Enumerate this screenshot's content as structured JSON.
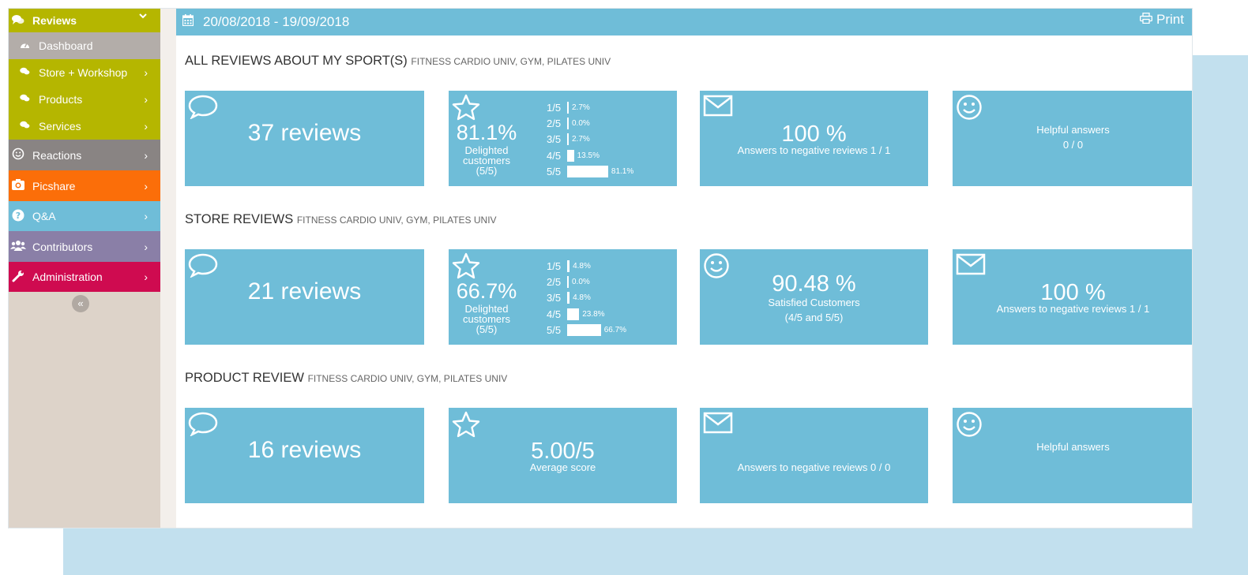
{
  "sidebar": {
    "items": [
      {
        "label": "Reviews",
        "icon": "comments-icon",
        "color": "#b5b600",
        "chevron": "⌄"
      },
      {
        "label": "Dashboard",
        "icon": "dashboard-icon",
        "color": "#b3ada9"
      },
      {
        "label": "Store + Workshop",
        "icon": "comments-icon",
        "color": "#b5b600",
        "chevron": "›"
      },
      {
        "label": "Products",
        "icon": "comments-icon",
        "color": "#b5b600",
        "chevron": "›"
      },
      {
        "label": "Services",
        "icon": "comments-icon",
        "color": "#b5b600",
        "chevron": "›"
      },
      {
        "label": "Reactions",
        "icon": "smile-icon",
        "color": "#898483",
        "chevron": "›"
      },
      {
        "label": "Picshare",
        "icon": "camera-icon",
        "color": "#fb6e09",
        "chevron": "›"
      },
      {
        "label": "Q&A",
        "icon": "question-icon",
        "color": "#6fbdd8",
        "chevron": "›"
      },
      {
        "label": "Contributors",
        "icon": "users-icon",
        "color": "#8a7fa7",
        "chevron": "›"
      },
      {
        "label": "Administration",
        "icon": "wrench-icon",
        "color": "#cf0b50",
        "chevron": "›"
      }
    ],
    "collapse_glyph": "«"
  },
  "topbar": {
    "date_range": "20/08/2018 - 19/09/2018",
    "print_label": "Print"
  },
  "sections": [
    {
      "title": "ALL REVIEWS ABOUT MY SPORT(S)",
      "subtitle": "FITNESS CARDIO UNIV, GYM, PILATES UNIV",
      "reviews_count": "37 reviews",
      "rating": {
        "percent": "81.1%",
        "label_lines": [
          "Delighted",
          "customers",
          "(5/5)"
        ],
        "distribution": [
          {
            "label": "1/5",
            "pct_text": "2.7%",
            "pct": 2.7
          },
          {
            "label": "2/5",
            "pct_text": "0.0%",
            "pct": 0.0
          },
          {
            "label": "3/5",
            "pct_text": "2.7%",
            "pct": 2.7
          },
          {
            "label": "4/5",
            "pct_text": "13.5%",
            "pct": 13.5
          },
          {
            "label": "5/5",
            "pct_text": "81.1%",
            "pct": 81.1
          }
        ]
      },
      "card3": {
        "icon": "envelope-icon",
        "value": "100 %",
        "label": "Answers to negative reviews 1 / 1"
      },
      "card4": {
        "icon": "smile-icon",
        "title": "Helpful answers",
        "value": "0 / 0"
      }
    },
    {
      "title": "STORE REVIEWS",
      "subtitle": "FITNESS CARDIO UNIV, GYM, PILATES UNIV",
      "reviews_count": "21 reviews",
      "rating": {
        "percent": "66.7%",
        "label_lines": [
          "Delighted",
          "customers",
          "(5/5)"
        ],
        "distribution": [
          {
            "label": "1/5",
            "pct_text": "4.8%",
            "pct": 4.8
          },
          {
            "label": "2/5",
            "pct_text": "0.0%",
            "pct": 0.0
          },
          {
            "label": "3/5",
            "pct_text": "4.8%",
            "pct": 4.8
          },
          {
            "label": "4/5",
            "pct_text": "23.8%",
            "pct": 23.8
          },
          {
            "label": "5/5",
            "pct_text": "66.7%",
            "pct": 66.7
          }
        ]
      },
      "card3": {
        "icon": "smile-icon",
        "value": "90.48 %",
        "label1": "Satisfied Customers",
        "label2": "(4/5 and 5/5)"
      },
      "card4": {
        "icon": "envelope-icon",
        "value": "100 %",
        "label": "Answers to negative reviews 1 / 1"
      }
    },
    {
      "title": "PRODUCT REVIEW",
      "subtitle": "FITNESS CARDIO UNIV, GYM, PILATES UNIV",
      "reviews_count": "16 reviews",
      "score": {
        "value": "5.00/5",
        "label": "Average score"
      },
      "card3": {
        "icon": "envelope-icon",
        "label": "Answers to negative reviews 0 / 0"
      },
      "card4": {
        "icon": "smile-icon",
        "title": "Helpful answers"
      }
    }
  ],
  "colors": {
    "card": "#6fbdd8",
    "accent_bg": "#c2e0ee"
  }
}
